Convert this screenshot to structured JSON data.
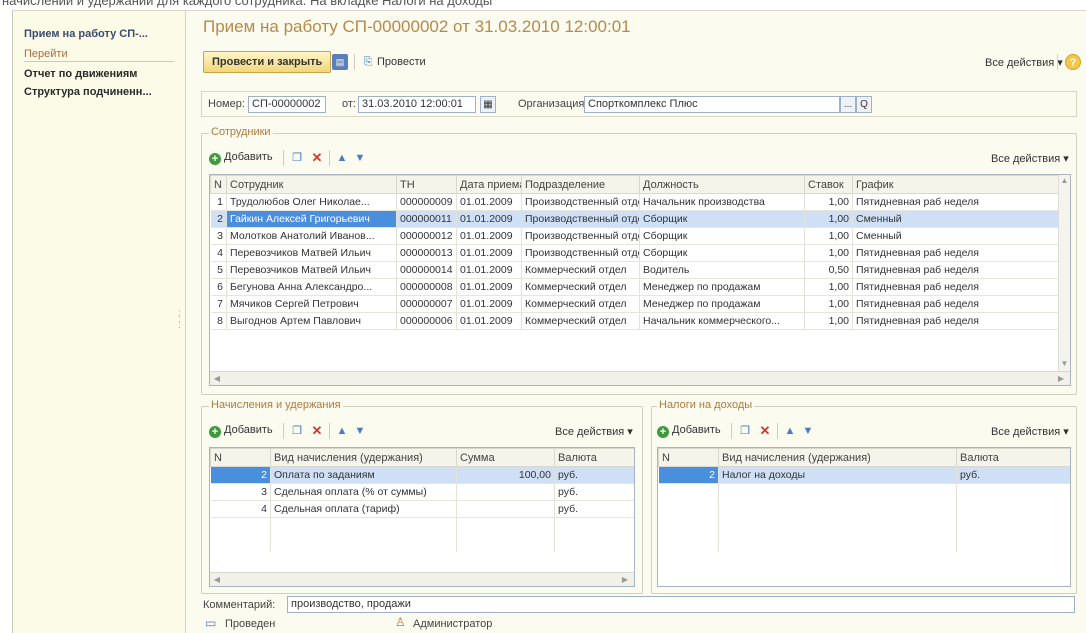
{
  "caption_fragment": "начислений и удержаний для каждого сотрудника. На вкладке Налоги на доходы",
  "sidebar": {
    "title": "Прием на работу СП-...",
    "goto_label": "Перейти",
    "links": [
      "Отчет по движениям",
      "Структура подчиненн..."
    ]
  },
  "doc": {
    "title": "Прием на работу СП-00000002 от 31.03.2010 12:00:01"
  },
  "toolbar": {
    "post_close_label": "Провести и закрыть",
    "post_label": "Провести",
    "all_actions_label": "Все действия",
    "help_glyph": "?"
  },
  "header": {
    "number_label": "Номер:",
    "number_value": "СП-00000002",
    "date_label": "от:",
    "date_value": "31.03.2010 12:00:01",
    "org_label": "Организация:",
    "org_value": "Спорткомплекс Плюс",
    "org_btn": "...",
    "org_search": "Q"
  },
  "employees": {
    "group_label": "Сотрудники",
    "add_label": "Добавить",
    "all_actions_label": "Все действия",
    "columns": [
      "N",
      "Сотрудник",
      "ТН",
      "Дата приема",
      "Подразделение",
      "Должность",
      "Ставок",
      "График"
    ],
    "rows": [
      [
        "1",
        "Трудолюбов Олег Николае...",
        "000000009",
        "01.01.2009",
        "Производственный отдел",
        "Начальник производства",
        "1,00",
        "Пятидневная раб неделя"
      ],
      [
        "2",
        "Гайкин Алексей Григорьевич",
        "000000011",
        "01.01.2009",
        "Производственный отдел",
        "Сборщик",
        "1,00",
        "Сменный"
      ],
      [
        "3",
        "Молотков Анатолий Иванов...",
        "000000012",
        "01.01.2009",
        "Производственный отдел",
        "Сборщик",
        "1,00",
        "Сменный"
      ],
      [
        "4",
        "Перевозчиков Матвей Ильич",
        "000000013",
        "01.01.2009",
        "Производственный отдел",
        "Сборщик",
        "1,00",
        "Пятидневная раб неделя"
      ],
      [
        "5",
        "Перевозчиков Матвей Ильич",
        "000000014",
        "01.01.2009",
        "Коммерческий отдел",
        "Водитель",
        "0,50",
        "Пятидневная раб неделя"
      ],
      [
        "6",
        "Бегунова Анна Александро...",
        "000000008",
        "01.01.2009",
        "Коммерческий отдел",
        "Менеджер по продажам",
        "1,00",
        "Пятидневная раб неделя"
      ],
      [
        "7",
        "Мячиков Сергей Петрович",
        "000000007",
        "01.01.2009",
        "Коммерческий отдел",
        "Менеджер по продажам",
        "1,00",
        "Пятидневная раб неделя"
      ],
      [
        "8",
        "Выгоднов Артем Павлович",
        "000000006",
        "01.01.2009",
        "Коммерческий отдел",
        "Начальник коммерческого...",
        "1,00",
        "Пятидневная раб неделя"
      ]
    ],
    "selected_row": 1
  },
  "accruals": {
    "group_label": "Начисления и удержания",
    "add_label": "Добавить",
    "all_actions_label": "Все действия",
    "columns": [
      "N",
      "Вид начисления (удержания)",
      "Сумма",
      "Валюта"
    ],
    "rows": [
      [
        "2",
        "Оплата по заданиям",
        "100,00",
        "руб."
      ],
      [
        "3",
        "Сдельная оплата (% от суммы)",
        "",
        "руб."
      ],
      [
        "4",
        "Сдельная оплата (тариф)",
        "",
        "руб."
      ]
    ]
  },
  "taxes": {
    "group_label": "Налоги на доходы",
    "add_label": "Добавить",
    "all_actions_label": "Все действия",
    "columns": [
      "N",
      "Вид начисления (удержания)",
      "Валюта"
    ],
    "rows": [
      [
        "2",
        "Налог на доходы",
        "руб."
      ]
    ]
  },
  "footer": {
    "comment_label": "Комментарий:",
    "comment_value": "производство, продажи",
    "status_label": "Проведен",
    "author_label": "Администратор"
  },
  "colors": {
    "title": "#b88a4a",
    "group_label": "#b07a3a",
    "selected_row": "#cfe0f6",
    "current_cell": "#4a8ede",
    "primary_button": "#f2d67a"
  }
}
